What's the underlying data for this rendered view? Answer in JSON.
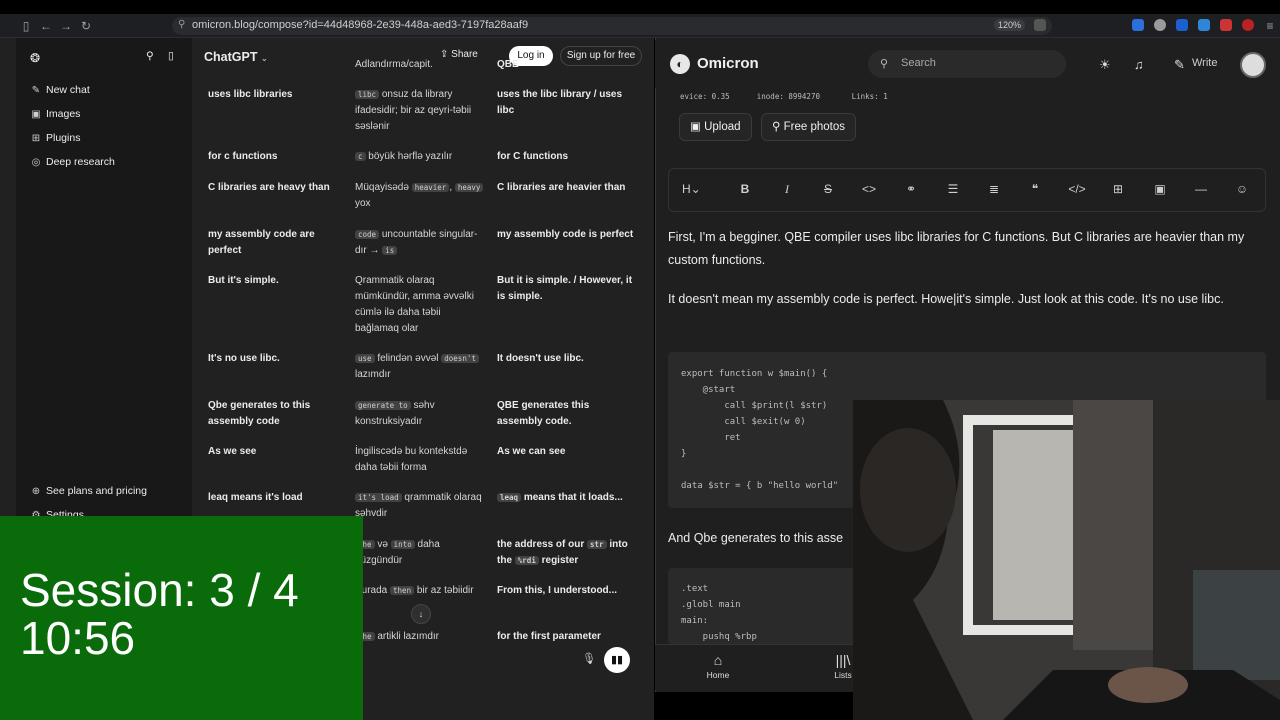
{
  "browser": {
    "url": "omicron.blog/compose?id=44d48968-2e39-448a-aed3-7197fa28aaf9",
    "zoom": "120%"
  },
  "chatgpt": {
    "title": "ChatGPT",
    "share": "Share",
    "login": "Log in",
    "signup": "Sign up for free",
    "sidebar": {
      "items": [
        "New chat",
        "Images",
        "Plugins",
        "Deep research"
      ],
      "plans": "See plans and pricing",
      "settings": "Settings"
    },
    "rows": [
      {
        "c1": "",
        "c2": "Adlandırma/capit.",
        "c3": "QBE"
      },
      {
        "c1": "uses libc libraries",
        "c2_code": "libc",
        "c2": "onsuz da library ifadesidir; bir az qeyri-təbii səslənir",
        "c3": "uses the libc library / uses libc"
      },
      {
        "c1": "for c functions",
        "c2_code": "c",
        "c2": "böyük hərflə yazılır",
        "c3": "for C functions"
      },
      {
        "c1": "C libraries are heavy than",
        "c2_pre": "Müqayisədə",
        "c2_code": "heavier",
        "c2_code2": "heavy",
        "c2": "yox",
        "c3": "C libraries are heavier than"
      },
      {
        "c1": "my assembly code are perfect",
        "c2_code": "code",
        "c2_mid": "uncountable singular-dır →",
        "c2_code2": "is",
        "c3": "my assembly code is perfect"
      },
      {
        "c1": "But it's simple.",
        "c2": "Qrammatik olaraq mümkündür, amma əvvəlki cümlə ilə daha təbii bağlamaq olar",
        "c3": "But it is simple. / However, it is simple."
      },
      {
        "c1": "It's no use libc.",
        "c2_code": "use",
        "c2_mid": "felindən əvvəl",
        "c2_code2": "doesn't",
        "c2": "lazımdır",
        "c3": "It doesn't use libc."
      },
      {
        "c1": "Qbe generates to this assembly code",
        "c2_code": "generate to",
        "c2": "səhv konstruksiyadır",
        "c3": "QBE generates this assembly code."
      },
      {
        "c1": "As we see",
        "c2": "İngiliscədə bu kontekstdə daha təbii forma",
        "c3": "As we can see"
      },
      {
        "c1": "leaq means it's load",
        "c2_code": "it's load",
        "c2": "qrammatik olaraq səhvdir",
        "c3_code": "leaq",
        "c3": "means that it loads..."
      },
      {
        "c1": "",
        "c2_code": "the",
        "c2_mid": "və",
        "c2_code2": "into",
        "c2": "daha düzgündür",
        "c3_pre": "the address of our",
        "c3_code": "str",
        "c3_mid": "into the",
        "c3_code2": "%rdi",
        "c3": "register"
      },
      {
        "c1": "",
        "c2_pre": "Burada",
        "c2_code": "then",
        "c2": "bir az təbiidir",
        "c3": "From this, I understood..."
      },
      {
        "c1": "",
        "c2_code": "the",
        "c2": "artikli lazımdır",
        "c3": "for the first parameter"
      }
    ]
  },
  "session": {
    "line1": "Session: 3 / 4",
    "line2": "10:56"
  },
  "omicron": {
    "brand": "Omicron",
    "search_placeholder": "Search",
    "write": "Write",
    "media_info": [
      "evice: 0.35",
      "inode: 8994270",
      "Links: 1"
    ],
    "upload": "Upload",
    "free_photos": "Free photos",
    "toolbar": [
      "H",
      "B",
      "I",
      "S",
      "<>",
      "link",
      "list",
      "olist",
      "quote",
      "</>",
      "table",
      "image",
      "hr",
      "emoji"
    ],
    "para1": "First, I'm a beggin­er.  QBE compiler uses libc libraries  for C functions.  But C libraries are heavier than my custom functions.",
    "para2": "It doesn't mean my assembly code is perfect.  Howe|it's simple.  Just look at this code. It's no use libc.",
    "code1": [
      "export function w $main() {",
      "    @start",
      "        call $print(l $str)",
      "        call $exit(w 0)",
      "        ret",
      "}",
      "",
      "data $str = { b \"hello world\""
    ],
    "para3": "And Qbe generates to this asse",
    "code2": [
      ".text",
      ".globl main",
      "main:",
      "    pushq %rbp"
    ],
    "nav": {
      "home": "Home",
      "lists": "Lists"
    }
  }
}
